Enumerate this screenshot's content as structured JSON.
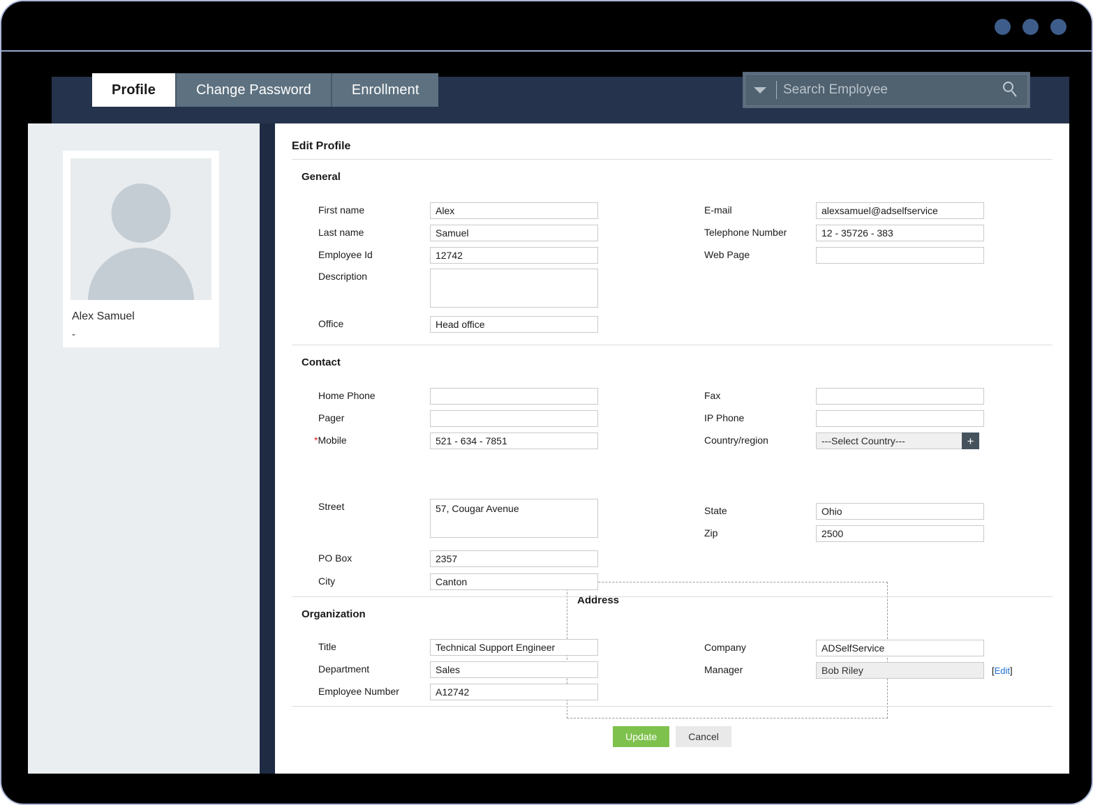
{
  "window": {
    "dots": [
      "window-dot-1",
      "window-dot-2",
      "window-dot-3"
    ],
    "dot_color": "#3f5d8a",
    "frame_color": "#000000"
  },
  "header": {
    "tabs": [
      {
        "label": "Profile",
        "active": true
      },
      {
        "label": "Change Password",
        "active": false
      },
      {
        "label": "Enrollment",
        "active": false
      }
    ],
    "search": {
      "placeholder": "Search Employee",
      "value": "",
      "caret_icon": "chevron-down-icon",
      "search_icon": "search-icon"
    },
    "band_color": "#25334c",
    "tab_inactive_color": "#5d7180"
  },
  "sidebar": {
    "avatar_icon": "user-placeholder-icon",
    "name": "Alex Samuel",
    "subtitle": "-"
  },
  "main": {
    "page_title": "Edit Profile",
    "sections": {
      "general": {
        "title": "General",
        "left": [
          {
            "label": "First name",
            "value": "Alex",
            "type": "text"
          },
          {
            "label": "Last name",
            "value": "Samuel",
            "type": "text"
          },
          {
            "label": "Employee Id",
            "value": "12742",
            "type": "text"
          },
          {
            "label": "Description",
            "value": "",
            "type": "textarea"
          },
          {
            "label": "Office",
            "value": "Head office",
            "type": "text"
          }
        ],
        "right": [
          {
            "label": "E-mail",
            "value": "alexsamuel@adselfservice",
            "type": "text"
          },
          {
            "label": "Telephone Number",
            "value": "12 - 35726 - 383",
            "type": "text"
          },
          {
            "label": "Web Page",
            "value": "",
            "type": "text"
          }
        ]
      },
      "contact": {
        "title": "Contact",
        "left": [
          {
            "label": "Home Phone",
            "value": "",
            "type": "text",
            "required": false
          },
          {
            "label": "Pager",
            "value": "",
            "type": "text",
            "required": false
          },
          {
            "label": "Mobile",
            "value": "521 - 634 - 7851",
            "type": "text",
            "required": true
          }
        ],
        "right": [
          {
            "label": "Fax",
            "value": "",
            "type": "text"
          },
          {
            "label": "IP Phone",
            "value": "",
            "type": "text"
          },
          {
            "label": "Country/region",
            "value": "---Select Country---",
            "type": "select",
            "add_button": "+"
          }
        ]
      },
      "address": {
        "title": "Address",
        "left": [
          {
            "label": "Street",
            "value": "57, Cougar Avenue",
            "type": "textarea"
          },
          {
            "label": "PO Box",
            "value": "2357",
            "type": "text"
          },
          {
            "label": "City",
            "value": "Canton",
            "type": "text"
          }
        ],
        "right": [
          {
            "label": "State",
            "value": "Ohio",
            "type": "text"
          },
          {
            "label": "Zip",
            "value": "2500",
            "type": "text"
          }
        ]
      },
      "organization": {
        "title": "Organization",
        "left": [
          {
            "label": "Title",
            "value": "Technical Support Engineer",
            "type": "text"
          },
          {
            "label": "Department",
            "value": "Sales",
            "type": "text"
          },
          {
            "label": "Employee Number",
            "value": "A12742",
            "type": "text"
          }
        ],
        "right": [
          {
            "label": "Company",
            "value": "ADSelfService",
            "type": "text"
          },
          {
            "label": "Manager",
            "value": "Bob Riley",
            "type": "text",
            "disabled": true,
            "edit_link": "Edit"
          }
        ]
      }
    },
    "buttons": {
      "update": "Update",
      "cancel": "Cancel",
      "update_color": "#7fc14d",
      "cancel_color": "#e9e9e9"
    }
  }
}
